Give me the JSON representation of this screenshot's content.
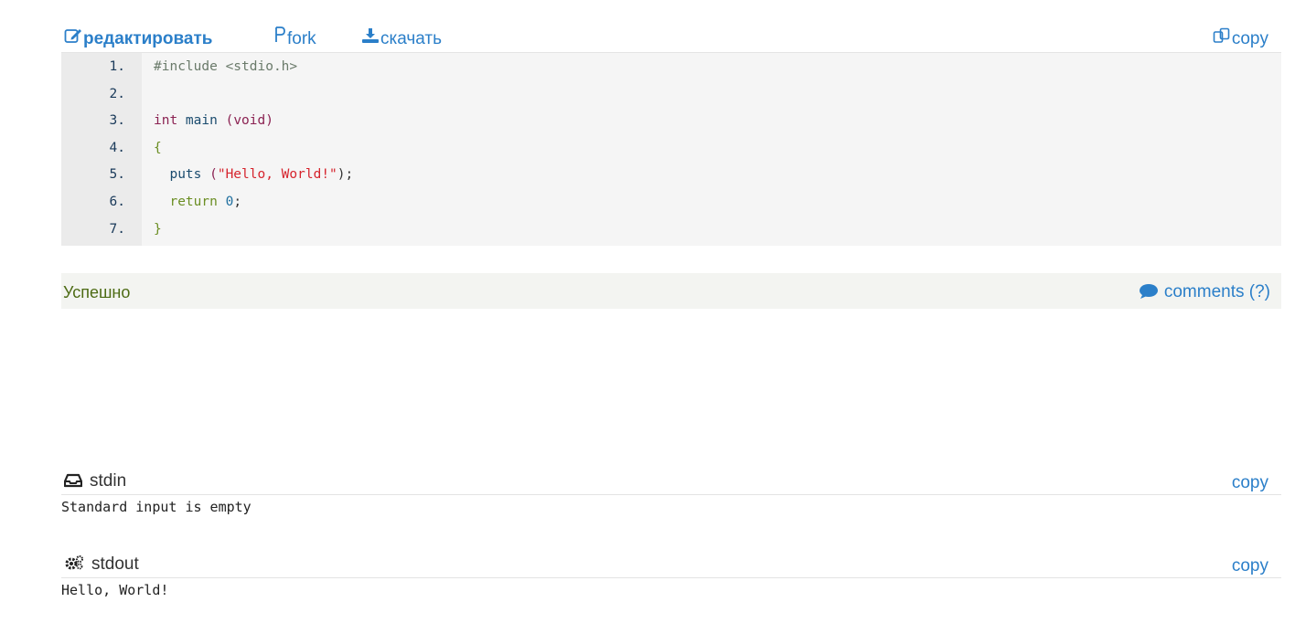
{
  "toolbar": {
    "edit_label": "редактировать",
    "fork_label": "fork",
    "download_label": "скачать",
    "copy_label": "copy"
  },
  "code": {
    "lines": [
      {
        "num": "1.",
        "parts": [
          {
            "t": "#include <stdio.h>",
            "c": "pre"
          }
        ]
      },
      {
        "num": "2.",
        "parts": []
      },
      {
        "num": "3.",
        "parts": [
          {
            "t": "int",
            "c": "type"
          },
          {
            "t": " main ",
            "c": "fn"
          },
          {
            "t": "(void)",
            "c": "type"
          }
        ]
      },
      {
        "num": "4.",
        "parts": [
          {
            "t": "{",
            "c": "plain"
          }
        ]
      },
      {
        "num": "5.",
        "parts": [
          {
            "t": "  puts ",
            "c": "fn"
          },
          {
            "t": "(",
            "c": "type"
          },
          {
            "t": "\"Hello, World!\"",
            "c": "str"
          },
          {
            "t": ");",
            "c": "paren"
          }
        ]
      },
      {
        "num": "6.",
        "parts": [
          {
            "t": "  return ",
            "c": "ret"
          },
          {
            "t": "0",
            "c": "num"
          },
          {
            "t": ";",
            "c": "paren"
          }
        ]
      },
      {
        "num": "7.",
        "parts": [
          {
            "t": "}",
            "c": "plain"
          }
        ]
      }
    ]
  },
  "status": {
    "text": "Успешно",
    "comments_label": "comments (?)"
  },
  "stdin": {
    "label": "stdin",
    "copy_label": "copy",
    "content": "Standard input is empty"
  },
  "stdout": {
    "label": "stdout",
    "copy_label": "copy",
    "content": "Hello, World!"
  },
  "colors": {
    "link": "#2b7fc9",
    "status_text": "#4d6b14",
    "code_bg": "#f5f5f5",
    "gutter_bg": "#ebebeb"
  }
}
